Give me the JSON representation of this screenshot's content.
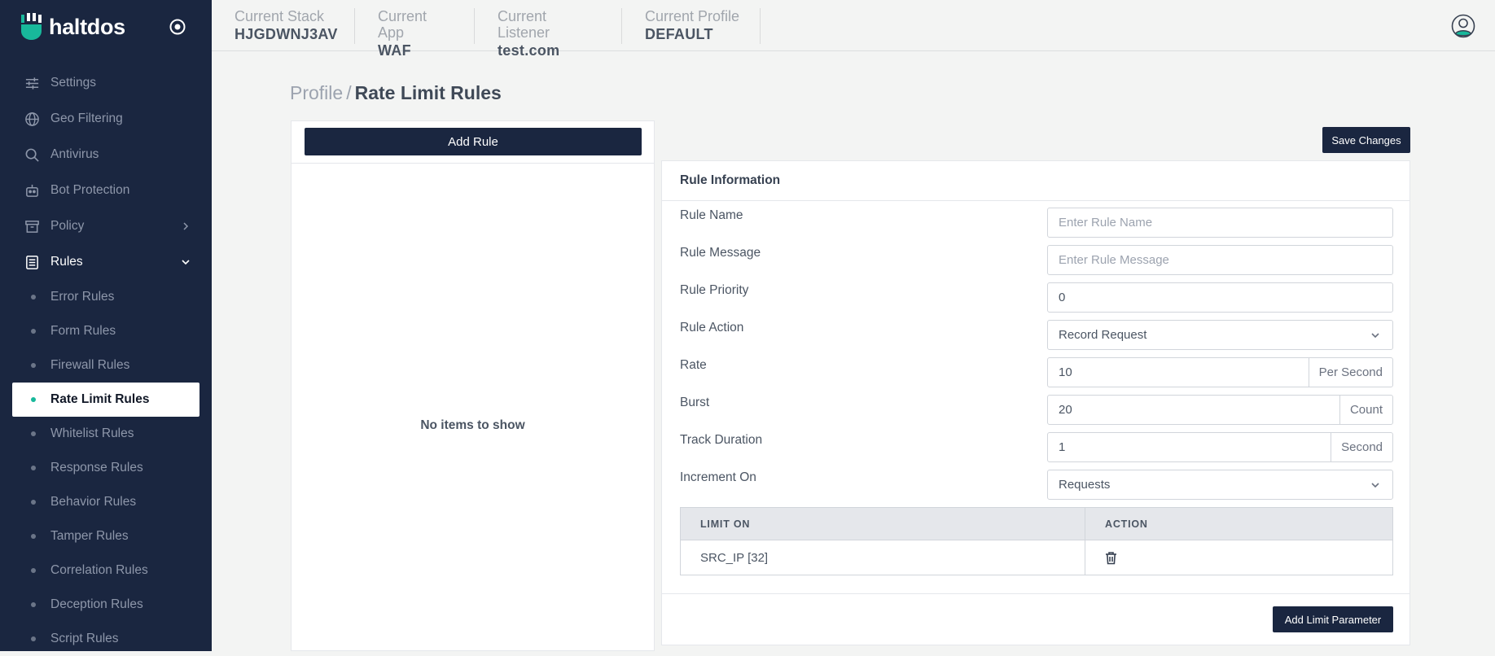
{
  "brand": {
    "name": "haltdos"
  },
  "colors": {
    "sidebar_bg": "#1a2640",
    "accent": "#18b89b",
    "button_bg": "#1a2640"
  },
  "sidebar": {
    "items": [
      {
        "label": "Settings",
        "icon": "sliders-icon"
      },
      {
        "label": "Geo Filtering",
        "icon": "globe-icon"
      },
      {
        "label": "Antivirus",
        "icon": "search-icon"
      },
      {
        "label": "Bot Protection",
        "icon": "robot-icon"
      },
      {
        "label": "Policy",
        "icon": "archive-icon",
        "expand": "chevron-right-icon"
      },
      {
        "label": "Rules",
        "icon": "list-icon",
        "expand": "chevron-down-icon"
      }
    ],
    "sub_items": [
      {
        "label": "Error Rules"
      },
      {
        "label": "Form Rules"
      },
      {
        "label": "Firewall Rules"
      },
      {
        "label": "Rate Limit Rules",
        "active": true
      },
      {
        "label": "Whitelist Rules"
      },
      {
        "label": "Response Rules"
      },
      {
        "label": "Behavior Rules"
      },
      {
        "label": "Tamper Rules"
      },
      {
        "label": "Correlation Rules"
      },
      {
        "label": "Deception Rules"
      },
      {
        "label": "Script Rules"
      }
    ]
  },
  "header": {
    "context": [
      {
        "label": "Current Stack",
        "value": "HJGDWNJ3AV"
      },
      {
        "label": "Current App",
        "value": "WAF"
      },
      {
        "label": "Current Listener",
        "value": "test.com"
      },
      {
        "label": "Current Profile",
        "value": "DEFAULT"
      }
    ]
  },
  "breadcrumb": {
    "parent": "Profile",
    "separator": "/",
    "current": "Rate Limit Rules"
  },
  "list_panel": {
    "add_label": "Add Rule",
    "empty_text": "No items to show"
  },
  "actions": {
    "save_label": "Save Changes",
    "add_param_label": "Add Limit Parameter"
  },
  "rule_info": {
    "title": "Rule Information",
    "rule_name": {
      "label": "Rule Name",
      "placeholder": "Enter Rule Name",
      "value": ""
    },
    "rule_message": {
      "label": "Rule Message",
      "placeholder": "Enter Rule Message",
      "value": ""
    },
    "rule_priority": {
      "label": "Rule Priority",
      "value": "0"
    },
    "rule_action": {
      "label": "Rule Action",
      "value": "Record Request"
    },
    "rate": {
      "label": "Rate",
      "value": "10",
      "unit": "Per Second"
    },
    "burst": {
      "label": "Burst",
      "value": "20",
      "unit": "Count"
    },
    "track_duration": {
      "label": "Track Duration",
      "value": "1",
      "unit": "Second"
    },
    "increment_on": {
      "label": "Increment On",
      "value": "Requests"
    }
  },
  "limits_table": {
    "columns": [
      "LIMIT ON",
      "ACTION"
    ],
    "rows": [
      {
        "limit_on": "SRC_IP [32]"
      }
    ]
  }
}
